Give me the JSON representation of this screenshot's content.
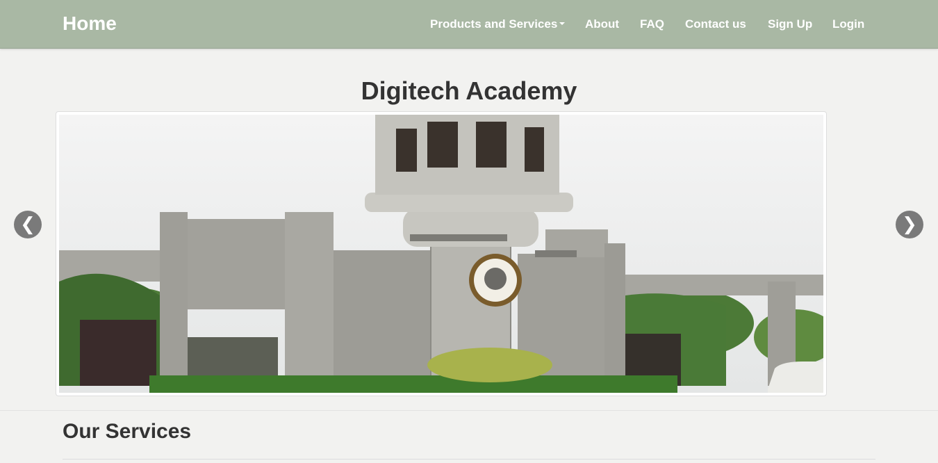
{
  "navbar": {
    "brand": "Home",
    "items": [
      {
        "label": "Products and Services",
        "dropdown": true
      },
      {
        "label": "About"
      },
      {
        "label": "FAQ"
      },
      {
        "label": "Contact us"
      },
      {
        "label": "Sign Up"
      },
      {
        "label": "Login"
      }
    ],
    "colors": {
      "background": "#a9b8a4",
      "text": "#ffffff"
    }
  },
  "hero": {
    "title": "Digitech Academy"
  },
  "carousel": {
    "image_subject": "university-gate-photo",
    "prev_symbol": "❮",
    "next_symbol": "❯"
  },
  "services": {
    "heading": "Our Services"
  }
}
